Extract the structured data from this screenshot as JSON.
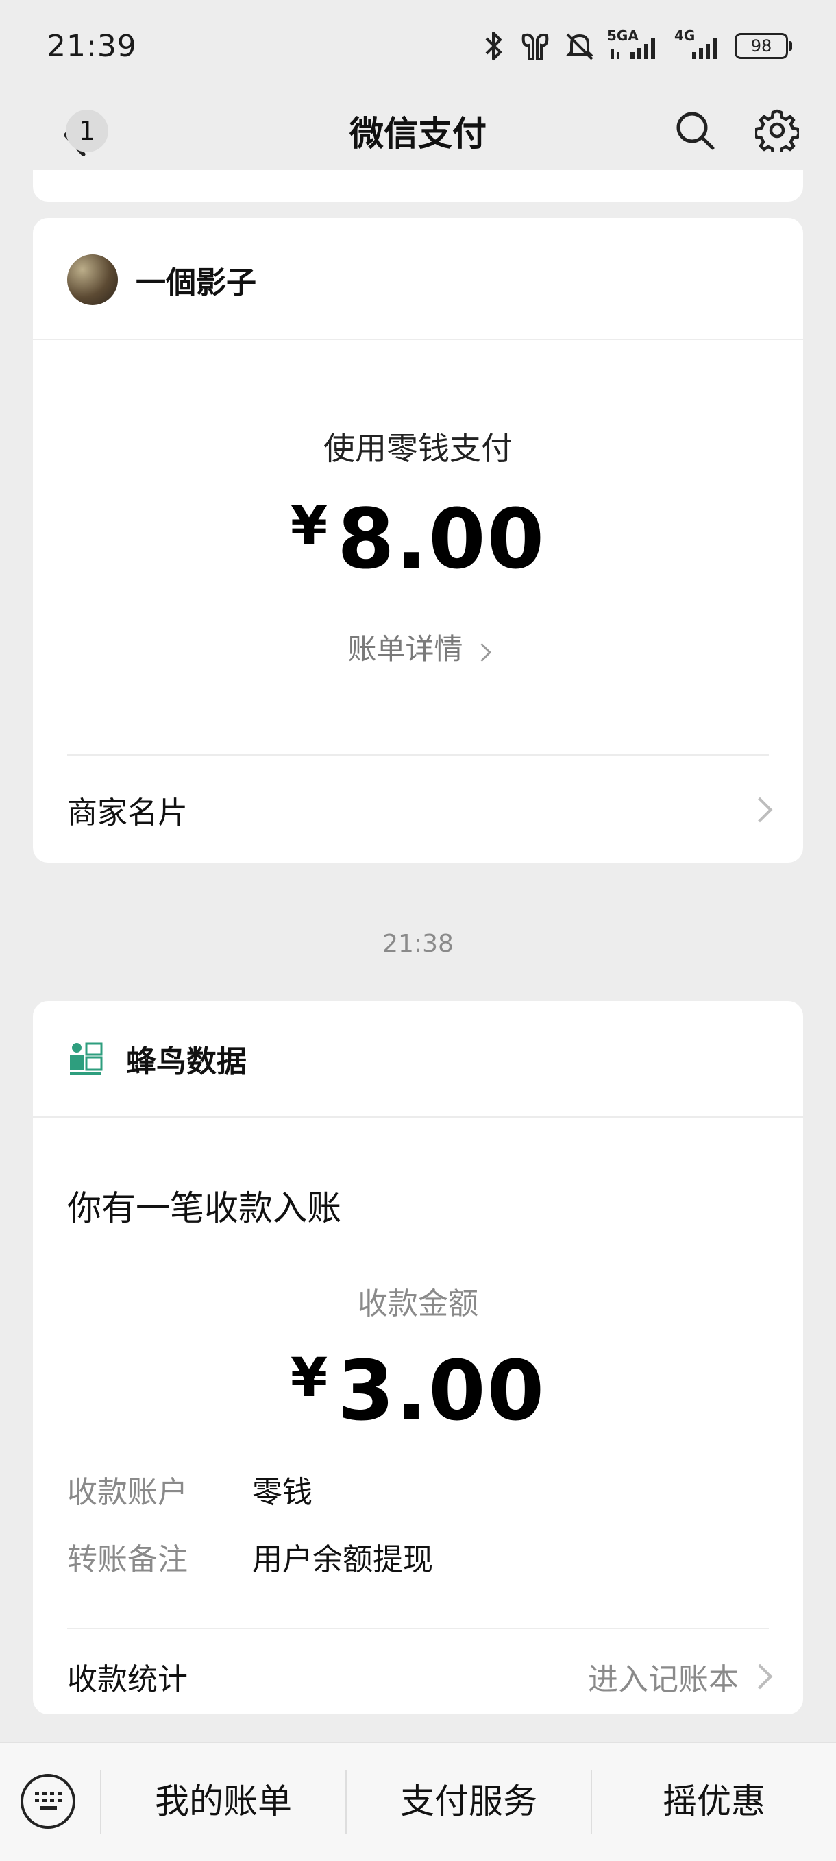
{
  "status_bar": {
    "time": "21:39",
    "network_1": "5GA",
    "network_2": "4G",
    "battery": "98"
  },
  "nav": {
    "back_badge": "1",
    "title": "微信支付"
  },
  "card1": {
    "merchant": "一個影子",
    "pay_method": "使用零钱支付",
    "currency": "¥",
    "amount": "8.00",
    "bill_details": "账单详情",
    "merchant_card": "商家名片"
  },
  "timestamp": "21:38",
  "card2": {
    "merchant": "蜂鸟数据",
    "notice": "你有一笔收款入账",
    "amount_label": "收款金额",
    "currency": "¥",
    "amount": "3.00",
    "account_key": "收款账户",
    "account_value": "零钱",
    "remark_key": "转账备注",
    "remark_value": "用户余额提现",
    "stats_label": "收款统计",
    "stats_link": "进入记账本"
  },
  "bottom_bar": {
    "tabs": [
      "我的账单",
      "支付服务",
      "摇优惠"
    ]
  }
}
